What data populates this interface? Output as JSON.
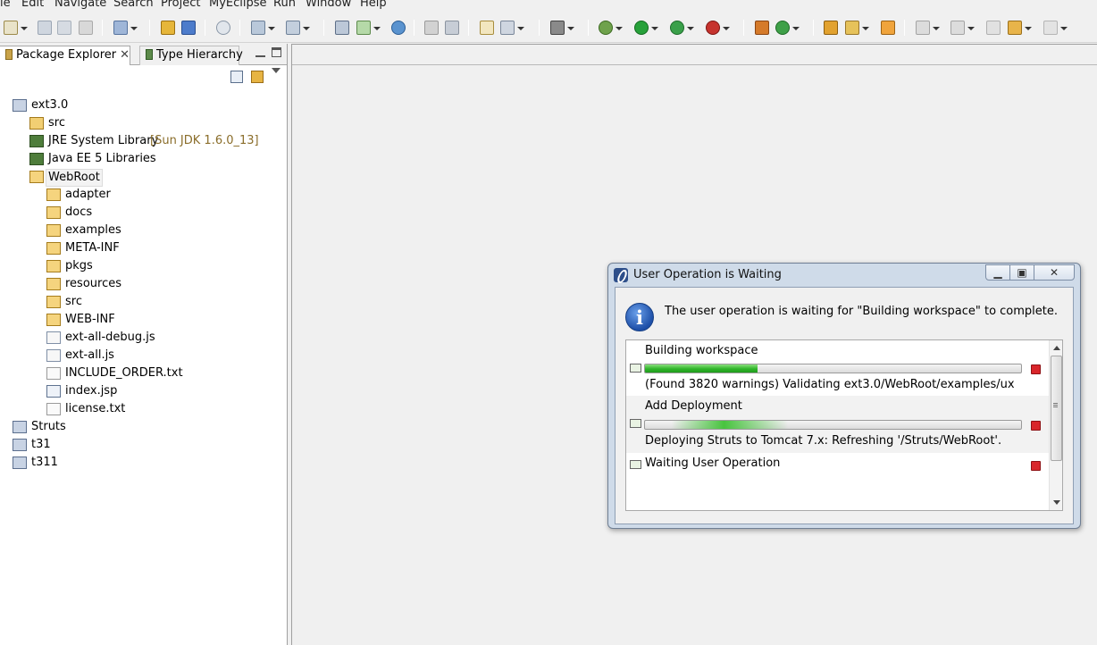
{
  "menu": [
    "le",
    "Edit",
    "Navigate",
    "Search",
    "Project",
    "MyEclipse",
    "Run",
    "Window",
    "Help"
  ],
  "left_panel": {
    "tabs": [
      {
        "label": "Package Explorer",
        "active": true
      },
      {
        "label": "Type Hierarchy",
        "active": false
      }
    ],
    "tree": [
      {
        "label": "ext3.0",
        "depth": 0,
        "icon": "project-icon"
      },
      {
        "label": "src",
        "depth": 1,
        "icon": "source-folder-icon"
      },
      {
        "label": "JRE System Library",
        "suffix": "[Sun JDK 1.6.0_13]",
        "depth": 1,
        "icon": "library-icon"
      },
      {
        "label": "Java EE 5 Libraries",
        "depth": 1,
        "icon": "library-icon"
      },
      {
        "label": "WebRoot",
        "depth": 1,
        "icon": "folder-open-icon",
        "selected": true
      },
      {
        "label": "adapter",
        "depth": 2,
        "icon": "folder-icon"
      },
      {
        "label": "docs",
        "depth": 2,
        "icon": "folder-icon"
      },
      {
        "label": "examples",
        "depth": 2,
        "icon": "folder-icon"
      },
      {
        "label": "META-INF",
        "depth": 2,
        "icon": "folder-icon"
      },
      {
        "label": "pkgs",
        "depth": 2,
        "icon": "folder-icon"
      },
      {
        "label": "resources",
        "depth": 2,
        "icon": "folder-icon"
      },
      {
        "label": "src",
        "depth": 2,
        "icon": "folder-icon"
      },
      {
        "label": "WEB-INF",
        "depth": 2,
        "icon": "folder-icon"
      },
      {
        "label": "ext-all-debug.js",
        "depth": 2,
        "icon": "js-file-icon"
      },
      {
        "label": "ext-all.js",
        "depth": 2,
        "icon": "js-file-icon"
      },
      {
        "label": "INCLUDE_ORDER.txt",
        "depth": 2,
        "icon": "text-file-icon"
      },
      {
        "label": "index.jsp",
        "depth": 2,
        "icon": "jsp-file-icon"
      },
      {
        "label": "license.txt",
        "depth": 2,
        "icon": "text-file-icon"
      },
      {
        "label": "Struts",
        "depth": 0,
        "icon": "project-icon"
      },
      {
        "label": "t31",
        "depth": 0,
        "icon": "project-icon"
      },
      {
        "label": "t311",
        "depth": 0,
        "icon": "project-icon"
      }
    ]
  },
  "dialog": {
    "title": "User Operation is Waiting",
    "message": "The user operation is waiting for \"Building workspace\" to complete.",
    "jobs": [
      {
        "name": "Building workspace",
        "progress": 0.3,
        "detail": "(Found 3820 warnings) Validating ext3.0/WebRoot/examples/ux",
        "icon": "build-job-icon"
      },
      {
        "name": "Add Deployment",
        "progress": null,
        "detail": "Deploying Struts to Tomcat  7.x: Refreshing '/Struts/WebRoot'.",
        "icon": "deploy-job-icon"
      },
      {
        "name": "Waiting User Operation",
        "icon": "waiting-job-icon"
      }
    ]
  },
  "colors": {
    "progress_green": "#2fb52a",
    "stop_red": "#d9262b",
    "library_suffix": "#8a6d2a",
    "info_blue": "#1d4fa8"
  }
}
